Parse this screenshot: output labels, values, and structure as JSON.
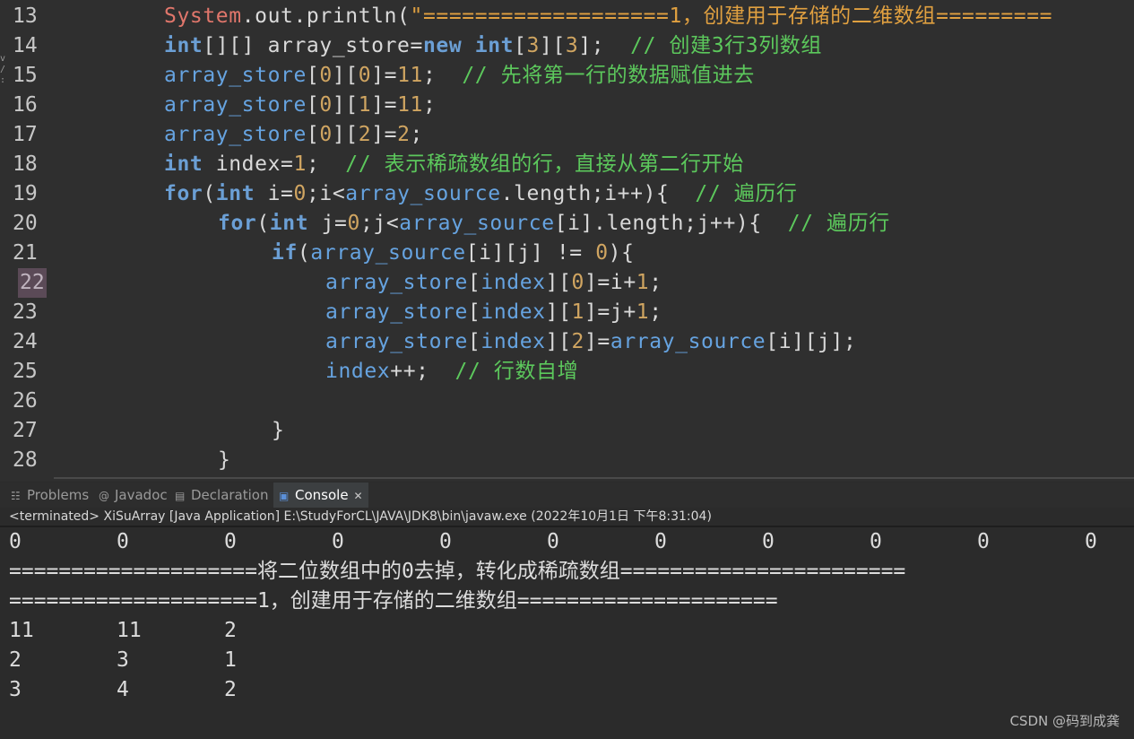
{
  "editor": {
    "lines": [
      {
        "no": "13",
        "segments": [
          [
            "sys",
            "System"
          ],
          [
            "plain",
            "."
          ],
          [
            "dotm",
            "out"
          ],
          [
            "plain",
            ".println("
          ],
          [
            "str",
            "\"===================1，创建用于存储的二维数组========="
          ]
        ]
      },
      {
        "no": "14",
        "segments": [
          [
            "kw2",
            "int"
          ],
          [
            "plain",
            "[][] array_store="
          ],
          [
            "kw2",
            "new"
          ],
          [
            "plain",
            " "
          ],
          [
            "kw2",
            "int"
          ],
          [
            "plain",
            "["
          ],
          [
            "num",
            "3"
          ],
          [
            "plain",
            "]["
          ],
          [
            "num",
            "3"
          ],
          [
            "plain",
            "];  "
          ],
          [
            "cm",
            "// 创建3行3列数组"
          ]
        ]
      },
      {
        "no": "15",
        "segments": [
          [
            "var",
            "array_store"
          ],
          [
            "plain",
            "["
          ],
          [
            "num",
            "0"
          ],
          [
            "plain",
            "]["
          ],
          [
            "num",
            "0"
          ],
          [
            "plain",
            "]="
          ],
          [
            "num",
            "11"
          ],
          [
            "plain",
            ";  "
          ],
          [
            "cm",
            "// 先将第一行的数据赋值进去"
          ]
        ]
      },
      {
        "no": "16",
        "segments": [
          [
            "var",
            "array_store"
          ],
          [
            "plain",
            "["
          ],
          [
            "num",
            "0"
          ],
          [
            "plain",
            "]["
          ],
          [
            "num",
            "1"
          ],
          [
            "plain",
            "]="
          ],
          [
            "num",
            "11"
          ],
          [
            "plain",
            ";"
          ]
        ]
      },
      {
        "no": "17",
        "segments": [
          [
            "var",
            "array_store"
          ],
          [
            "plain",
            "["
          ],
          [
            "num",
            "0"
          ],
          [
            "plain",
            "]["
          ],
          [
            "num",
            "2"
          ],
          [
            "plain",
            "]="
          ],
          [
            "num",
            "2"
          ],
          [
            "plain",
            ";"
          ]
        ]
      },
      {
        "no": "18",
        "segments": [
          [
            "kw2",
            "int"
          ],
          [
            "plain",
            " index="
          ],
          [
            "num",
            "1"
          ],
          [
            "plain",
            ";  "
          ],
          [
            "cm",
            "// 表示稀疏数组的行，直接从第二行开始"
          ]
        ]
      },
      {
        "no": "19",
        "segments": [
          [
            "kw2",
            "for"
          ],
          [
            "plain",
            "("
          ],
          [
            "kw2",
            "int"
          ],
          [
            "plain",
            " i="
          ],
          [
            "num",
            "0"
          ],
          [
            "plain",
            ";i<"
          ],
          [
            "var",
            "array_source"
          ],
          [
            "plain",
            ".length;i++){  "
          ],
          [
            "cm",
            "// 遍历行"
          ]
        ]
      },
      {
        "no": "20",
        "indent": 1,
        "segments": [
          [
            "kw2",
            "for"
          ],
          [
            "plain",
            "("
          ],
          [
            "kw2",
            "int"
          ],
          [
            "plain",
            " j="
          ],
          [
            "num",
            "0"
          ],
          [
            "plain",
            ";j<"
          ],
          [
            "var",
            "array_source"
          ],
          [
            "plain",
            "[i].length;j++){  "
          ],
          [
            "cm",
            "// 遍历行"
          ]
        ]
      },
      {
        "no": "21",
        "indent": 2,
        "segments": [
          [
            "kw2",
            "if"
          ],
          [
            "plain",
            "("
          ],
          [
            "var",
            "array_source"
          ],
          [
            "plain",
            "[i][j] != "
          ],
          [
            "num",
            "0"
          ],
          [
            "plain",
            "){"
          ]
        ]
      },
      {
        "no": "22",
        "indent": 3,
        "current": true,
        "segments": [
          [
            "var",
            "array_store"
          ],
          [
            "plain",
            "["
          ],
          [
            "var",
            "index"
          ],
          [
            "plain",
            "]["
          ],
          [
            "num",
            "0"
          ],
          [
            "plain",
            "]=i+"
          ],
          [
            "num",
            "1"
          ],
          [
            "plain",
            ";"
          ]
        ]
      },
      {
        "no": "23",
        "indent": 3,
        "segments": [
          [
            "var",
            "array_store"
          ],
          [
            "plain",
            "["
          ],
          [
            "var",
            "index"
          ],
          [
            "plain",
            "]["
          ],
          [
            "num",
            "1"
          ],
          [
            "plain",
            "]=j+"
          ],
          [
            "num",
            "1"
          ],
          [
            "plain",
            ";"
          ]
        ]
      },
      {
        "no": "24",
        "indent": 3,
        "segments": [
          [
            "var",
            "array_store"
          ],
          [
            "plain",
            "["
          ],
          [
            "var",
            "index"
          ],
          [
            "plain",
            "]["
          ],
          [
            "num",
            "2"
          ],
          [
            "plain",
            "]="
          ],
          [
            "var",
            "array_source"
          ],
          [
            "plain",
            "[i][j];"
          ]
        ]
      },
      {
        "no": "25",
        "indent": 3,
        "segments": [
          [
            "var",
            "index"
          ],
          [
            "plain",
            "++;  "
          ],
          [
            "cm",
            "// 行数自增"
          ]
        ]
      },
      {
        "no": "26",
        "indent": 0,
        "segments": []
      },
      {
        "no": "27",
        "indent": 2,
        "segments": [
          [
            "plain",
            "}"
          ]
        ]
      },
      {
        "no": "28",
        "indent": 1,
        "segments": [
          [
            "plain",
            "}"
          ]
        ]
      }
    ]
  },
  "tabs": [
    {
      "label": "Problems",
      "icon": "problems-icon",
      "glyph": "☷"
    },
    {
      "label": "Javadoc",
      "icon": "javadoc-icon",
      "glyph": "@"
    },
    {
      "label": "Declaration",
      "icon": "declaration-icon",
      "glyph": "▤"
    },
    {
      "label": "Console",
      "icon": "console-icon",
      "glyph": "▣",
      "active": true,
      "close": "✕"
    }
  ],
  "console": {
    "header": "<terminated> XiSuArray [Java Application] E:\\StudyForCL\\JAVA\\JDK8\\bin\\javaw.exe (2022年10月1日 下午8:31:04)",
    "zero_row": [
      "0",
      "0",
      "0",
      "0",
      "0",
      "0",
      "0",
      "0",
      "0",
      "0",
      "0"
    ],
    "line_convert": "====================将二位数组中的0去掉，转化成稀疏数组=======================",
    "line_create": "====================1，创建用于存储的二维数组=====================",
    "rows": [
      [
        "11",
        "11",
        "2"
      ],
      [
        "2",
        "3",
        "1"
      ],
      [
        "3",
        "4",
        "2"
      ]
    ]
  },
  "watermark": "CSDN @码到成龚"
}
